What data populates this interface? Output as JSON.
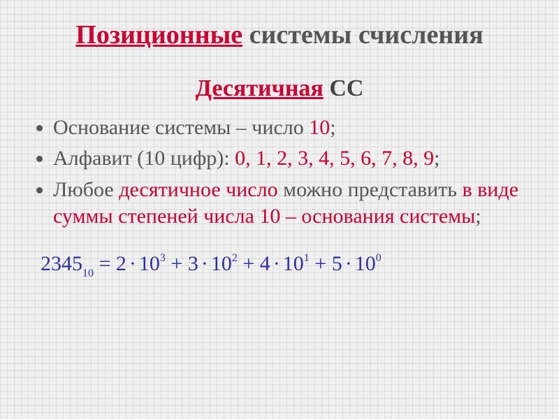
{
  "title": {
    "word1": "Позиционные",
    "rest": " системы счисления"
  },
  "subtitle": {
    "word1": "Десятичная",
    "rest": " СС"
  },
  "bullets": {
    "b1": {
      "t0": "Основание системы – число ",
      "t1": "10",
      "t2": ";"
    },
    "b2": {
      "t0": "Алфавит (",
      "t1": "10 цифр",
      "t2": "): ",
      "t3": "0, 1, 2, 3, 4, 5, 6, 7, 8, 9",
      "t4": ";"
    },
    "b3": {
      "t0": "Любое ",
      "t1": "десятичное число",
      "t2": " можно представить ",
      "t3": "в виде суммы степеней числа 10 – основания системы",
      "t4": ";"
    }
  },
  "formula": {
    "lhs_num": "2345",
    "lhs_sub": "10",
    "eq": " = ",
    "terms": [
      {
        "coef": "2",
        "base": "10",
        "exp": "3"
      },
      {
        "coef": "3",
        "base": "10",
        "exp": "2"
      },
      {
        "coef": "4",
        "base": "10",
        "exp": "1"
      },
      {
        "coef": "5",
        "base": "10",
        "exp": "0"
      }
    ],
    "dot": "·",
    "plus": " + "
  }
}
